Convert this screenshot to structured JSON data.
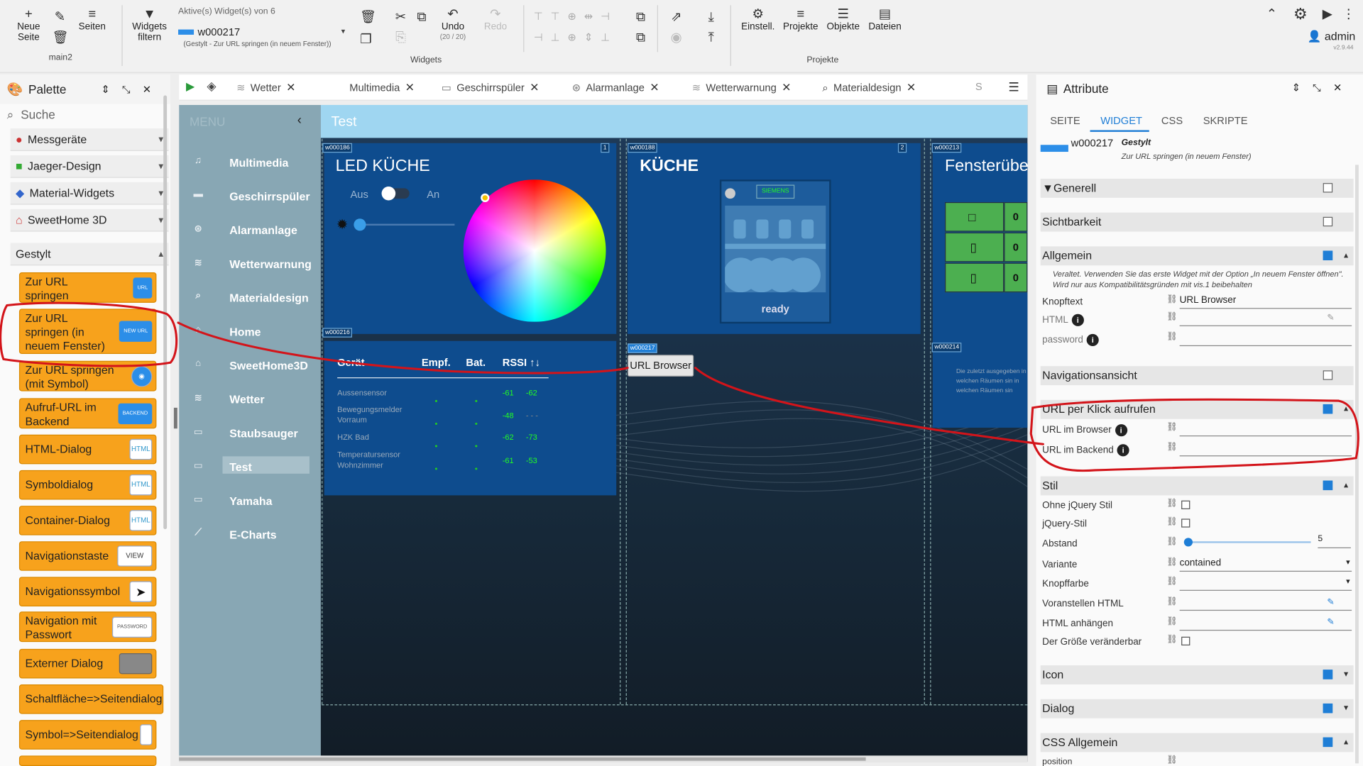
{
  "toolbar": {
    "new_page": "Neue Seite",
    "pages": "Seiten",
    "page_name": "main2",
    "filter": "Widgets filtern",
    "active_label": "Aktive(s) Widget(s) von 6",
    "widget_id": "w000217",
    "widget_desc": "(Gestylt - Zur URL springen (in neuem Fenster))",
    "undo": "Undo",
    "undo_count": "(20 / 20)",
    "redo": "Redo",
    "widgets_group": "Widgets",
    "settings": "Einstell.",
    "projects": "Projekte",
    "objects": "Objekte",
    "files": "Dateien",
    "projects_group": "Projekte",
    "user": "admin",
    "version": "v2.9.44"
  },
  "palette": {
    "title": "Palette",
    "search_placeholder": "Suche",
    "categories": [
      "Messgeräte",
      "Jaeger-Design",
      "Material-Widgets",
      "SweetHome 3D"
    ],
    "group": "Gestylt",
    "items": [
      {
        "label": "Zur URL springen",
        "tag": "URL"
      },
      {
        "label": "Zur URL springen (in neuem Fenster)",
        "tag": "NEW URL"
      },
      {
        "label": "Zur URL springen (mit Symbol)",
        "tag": ""
      },
      {
        "label": "Aufruf-URL im Backend",
        "tag": "BACKEND"
      },
      {
        "label": "HTML-Dialog",
        "tag": "HTML"
      },
      {
        "label": "Symboldialog",
        "tag": "HTML"
      },
      {
        "label": "Container-Dialog",
        "tag": "HTML"
      },
      {
        "label": "Navigationstaste",
        "tag": "VIEW"
      },
      {
        "label": "Navigationssymbol",
        "tag": ""
      },
      {
        "label": "Navigation mit Passwort",
        "tag": "PASSWORD"
      },
      {
        "label": "Externer Dialog",
        "tag": ""
      },
      {
        "label": "Schaltfläche=>Seitendialog",
        "tag": ""
      },
      {
        "label": "Symbol=>Seitendialog",
        "tag": ""
      }
    ]
  },
  "tabs": [
    "Wetter",
    "Multimedia",
    "Geschirrspüler",
    "Alarmanlage",
    "Wetterwarnung",
    "Materialdesign",
    "S"
  ],
  "menu": {
    "header": "MENU",
    "items": [
      "Multimedia",
      "Geschirrspüler",
      "Alarmanlage",
      "Wetterwarnung",
      "Materialdesign",
      "Home",
      "SweetHome3D",
      "Wetter",
      "Staubsauger",
      "Test",
      "Yamaha",
      "E-Charts"
    ]
  },
  "view": {
    "title": "Test",
    "led": {
      "id": "w000186",
      "title": "LED KÜCHE",
      "off": "Aus",
      "on": "An"
    },
    "kitchen": {
      "id": "w000188",
      "title": "KÜCHE",
      "brand": "SIEMENS",
      "status": "ready"
    },
    "window": {
      "id": "w000213",
      "title": "Fensterübe",
      "rows": [
        "0",
        "0",
        "0"
      ]
    },
    "table": {
      "id": "w000216",
      "headers": [
        "Gerät",
        "Empf.",
        "Bat.",
        "RSSI ↑↓"
      ],
      "rows": [
        [
          "Aussensensor",
          "-61",
          "-62"
        ],
        [
          "Bewegungsmelder Vorraum",
          "-48",
          "- - -"
        ],
        [
          "HZK Bad",
          "-62",
          "-73"
        ],
        [
          "Temperatursensor Wohnzimmer",
          "-61",
          "-53"
        ]
      ]
    },
    "button": {
      "id": "w000217",
      "label": "URL Browser"
    },
    "info": {
      "id": "w000214",
      "text": "Die zuletzt ausgegeben in welchen Räumen sin in welchen Räumen sin"
    },
    "badges": {
      "b1": "1",
      "b2": "2"
    }
  },
  "attributes": {
    "title": "Attribute",
    "tabs": [
      "SEITE",
      "WIDGET",
      "CSS",
      "SKRIPTE"
    ],
    "widget_id": "w000217",
    "widget_style": "Gestylt",
    "widget_desc": "Zur URL springen (in neuem Fenster)",
    "sections": {
      "generell": "Generell",
      "sichtbarkeit": "Sichtbarkeit",
      "allgemein": "Allgemein",
      "navigation": "Navigationsansicht",
      "url": "URL per Klick aufrufen",
      "stil": "Stil",
      "icon": "Icon",
      "dialog": "Dialog",
      "css": "CSS Allgemein"
    },
    "deprecated": "Veraltet. Verwenden Sie das erste Widget mit der Option „In neuem Fenster öffnen\". Wird nur aus Kompatibilitätsgründen mit vis.1 beibehalten",
    "knopftext_label": "Knopftext",
    "knopftext": "URL Browser",
    "html_label": "HTML",
    "password_label": "password",
    "url_browser": "URL im Browser",
    "url_backend": "URL im Backend",
    "style": {
      "ohne_jquery": "Ohne jQuery Stil",
      "jquery": "jQuery-Stil",
      "abstand": "Abstand",
      "abstand_value": "5",
      "variante": "Variante",
      "variante_value": "contained",
      "knopffarbe": "Knopffarbe",
      "prepend": "Voranstellen HTML",
      "append": "HTML anhängen",
      "resize": "Der Größe veränderbar"
    },
    "position": "position"
  }
}
